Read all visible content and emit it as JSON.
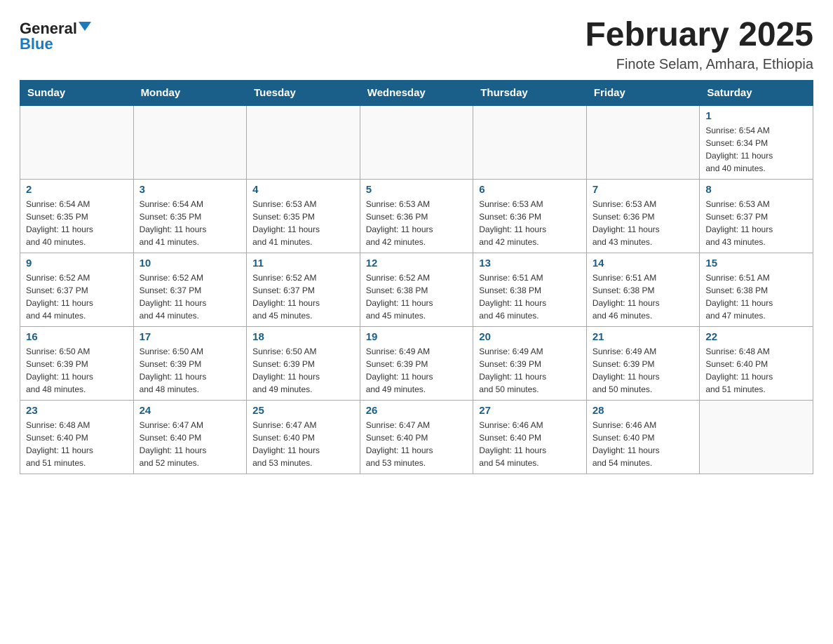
{
  "logo": {
    "general": "General",
    "blue": "Blue",
    "aria": "GeneralBlue logo"
  },
  "title": "February 2025",
  "subtitle": "Finote Selam, Amhara, Ethiopia",
  "days_of_week": [
    "Sunday",
    "Monday",
    "Tuesday",
    "Wednesday",
    "Thursday",
    "Friday",
    "Saturday"
  ],
  "weeks": [
    [
      {
        "day": "",
        "info": ""
      },
      {
        "day": "",
        "info": ""
      },
      {
        "day": "",
        "info": ""
      },
      {
        "day": "",
        "info": ""
      },
      {
        "day": "",
        "info": ""
      },
      {
        "day": "",
        "info": ""
      },
      {
        "day": "1",
        "info": "Sunrise: 6:54 AM\nSunset: 6:34 PM\nDaylight: 11 hours\nand 40 minutes."
      }
    ],
    [
      {
        "day": "2",
        "info": "Sunrise: 6:54 AM\nSunset: 6:35 PM\nDaylight: 11 hours\nand 40 minutes."
      },
      {
        "day": "3",
        "info": "Sunrise: 6:54 AM\nSunset: 6:35 PM\nDaylight: 11 hours\nand 41 minutes."
      },
      {
        "day": "4",
        "info": "Sunrise: 6:53 AM\nSunset: 6:35 PM\nDaylight: 11 hours\nand 41 minutes."
      },
      {
        "day": "5",
        "info": "Sunrise: 6:53 AM\nSunset: 6:36 PM\nDaylight: 11 hours\nand 42 minutes."
      },
      {
        "day": "6",
        "info": "Sunrise: 6:53 AM\nSunset: 6:36 PM\nDaylight: 11 hours\nand 42 minutes."
      },
      {
        "day": "7",
        "info": "Sunrise: 6:53 AM\nSunset: 6:36 PM\nDaylight: 11 hours\nand 43 minutes."
      },
      {
        "day": "8",
        "info": "Sunrise: 6:53 AM\nSunset: 6:37 PM\nDaylight: 11 hours\nand 43 minutes."
      }
    ],
    [
      {
        "day": "9",
        "info": "Sunrise: 6:52 AM\nSunset: 6:37 PM\nDaylight: 11 hours\nand 44 minutes."
      },
      {
        "day": "10",
        "info": "Sunrise: 6:52 AM\nSunset: 6:37 PM\nDaylight: 11 hours\nand 44 minutes."
      },
      {
        "day": "11",
        "info": "Sunrise: 6:52 AM\nSunset: 6:37 PM\nDaylight: 11 hours\nand 45 minutes."
      },
      {
        "day": "12",
        "info": "Sunrise: 6:52 AM\nSunset: 6:38 PM\nDaylight: 11 hours\nand 45 minutes."
      },
      {
        "day": "13",
        "info": "Sunrise: 6:51 AM\nSunset: 6:38 PM\nDaylight: 11 hours\nand 46 minutes."
      },
      {
        "day": "14",
        "info": "Sunrise: 6:51 AM\nSunset: 6:38 PM\nDaylight: 11 hours\nand 46 minutes."
      },
      {
        "day": "15",
        "info": "Sunrise: 6:51 AM\nSunset: 6:38 PM\nDaylight: 11 hours\nand 47 minutes."
      }
    ],
    [
      {
        "day": "16",
        "info": "Sunrise: 6:50 AM\nSunset: 6:39 PM\nDaylight: 11 hours\nand 48 minutes."
      },
      {
        "day": "17",
        "info": "Sunrise: 6:50 AM\nSunset: 6:39 PM\nDaylight: 11 hours\nand 48 minutes."
      },
      {
        "day": "18",
        "info": "Sunrise: 6:50 AM\nSunset: 6:39 PM\nDaylight: 11 hours\nand 49 minutes."
      },
      {
        "day": "19",
        "info": "Sunrise: 6:49 AM\nSunset: 6:39 PM\nDaylight: 11 hours\nand 49 minutes."
      },
      {
        "day": "20",
        "info": "Sunrise: 6:49 AM\nSunset: 6:39 PM\nDaylight: 11 hours\nand 50 minutes."
      },
      {
        "day": "21",
        "info": "Sunrise: 6:49 AM\nSunset: 6:39 PM\nDaylight: 11 hours\nand 50 minutes."
      },
      {
        "day": "22",
        "info": "Sunrise: 6:48 AM\nSunset: 6:40 PM\nDaylight: 11 hours\nand 51 minutes."
      }
    ],
    [
      {
        "day": "23",
        "info": "Sunrise: 6:48 AM\nSunset: 6:40 PM\nDaylight: 11 hours\nand 51 minutes."
      },
      {
        "day": "24",
        "info": "Sunrise: 6:47 AM\nSunset: 6:40 PM\nDaylight: 11 hours\nand 52 minutes."
      },
      {
        "day": "25",
        "info": "Sunrise: 6:47 AM\nSunset: 6:40 PM\nDaylight: 11 hours\nand 53 minutes."
      },
      {
        "day": "26",
        "info": "Sunrise: 6:47 AM\nSunset: 6:40 PM\nDaylight: 11 hours\nand 53 minutes."
      },
      {
        "day": "27",
        "info": "Sunrise: 6:46 AM\nSunset: 6:40 PM\nDaylight: 11 hours\nand 54 minutes."
      },
      {
        "day": "28",
        "info": "Sunrise: 6:46 AM\nSunset: 6:40 PM\nDaylight: 11 hours\nand 54 minutes."
      },
      {
        "day": "",
        "info": ""
      }
    ]
  ]
}
